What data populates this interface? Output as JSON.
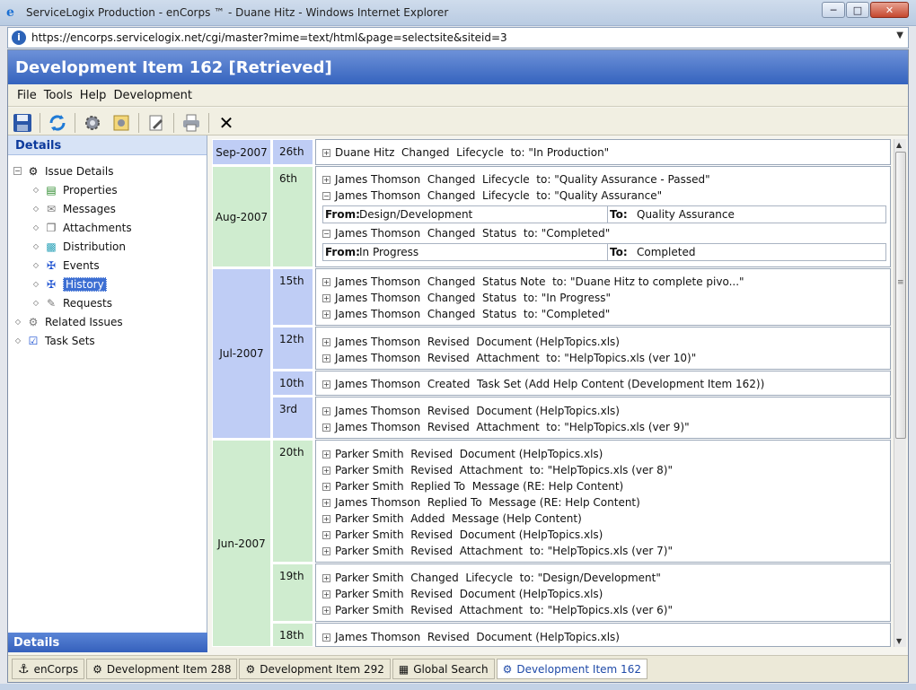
{
  "window": {
    "title": "ServiceLogix Production - enCorps ™ - Duane Hitz - Windows Internet Explorer",
    "url": "https://encorps.servicelogix.net/cgi/master?mime=text/html&page=selectsite&siteid=3"
  },
  "app": {
    "title": "Development Item 162 [Retrieved]"
  },
  "menu": {
    "file": "File",
    "tools": "Tools",
    "help": "Help",
    "development": "Development"
  },
  "toolbar": {
    "icons": [
      "save-icon",
      "refresh-icon",
      "settings-icon",
      "properties-icon",
      "edit-icon",
      "print-icon",
      "close-icon"
    ],
    "close": "✕"
  },
  "sidebar": {
    "header": "Details",
    "footer": "Details",
    "items": [
      {
        "label": "Issue Details"
      },
      {
        "label": "Properties"
      },
      {
        "label": "Messages"
      },
      {
        "label": "Attachments"
      },
      {
        "label": "Distribution"
      },
      {
        "label": "Events"
      },
      {
        "label": "History"
      },
      {
        "label": "Requests"
      },
      {
        "label": "Related Issues"
      },
      {
        "label": "Task Sets"
      }
    ]
  },
  "history": {
    "months": [
      "Sep-2007",
      "Aug-2007",
      "Jul-2007",
      "Jun-2007"
    ],
    "days": [
      "26th",
      "6th",
      "15th",
      "12th",
      "10th",
      "3rd",
      "20th",
      "19th",
      "18th"
    ],
    "rows": [
      "Duane Hitz  Changed  Lifecycle  to: \"In Production\"",
      "James Thomson  Changed  Lifecycle  to: \"Quality Assurance - Passed\"",
      "James Thomson  Changed  Lifecycle  to: \"Quality Assurance\"",
      "James Thomson  Changed  Status  to: \"Completed\"",
      "James Thomson  Changed  Status Note  to: \"Duane Hitz to complete pivo...\"",
      "James Thomson  Changed  Status  to: \"In Progress\"",
      "James Thomson  Changed  Status  to: \"Completed\"",
      "James Thomson  Revised  Document (HelpTopics.xls)",
      "James Thomson  Revised  Attachment  to: \"HelpTopics.xls (ver 10)\"",
      "James Thomson  Created  Task Set (Add Help Content (Development Item 162))",
      "James Thomson  Revised  Document (HelpTopics.xls)",
      "James Thomson  Revised  Attachment  to: \"HelpTopics.xls (ver 9)\"",
      "Parker Smith  Revised  Document (HelpTopics.xls)",
      "Parker Smith  Revised  Attachment  to: \"HelpTopics.xls (ver 8)\"",
      "Parker Smith  Replied To  Message (RE: Help Content)",
      "James Thomson  Replied To  Message (RE: Help Content)",
      "Parker Smith  Added  Message (Help Content)",
      "Parker Smith  Revised  Document (HelpTopics.xls)",
      "Parker Smith  Revised  Attachment  to: \"HelpTopics.xls (ver 7)\"",
      "Parker Smith  Changed  Lifecycle  to: \"Design/Development\"",
      "Parker Smith  Revised  Document (HelpTopics.xls)",
      "Parker Smith  Revised  Attachment  to: \"HelpTopics.xls (ver 6)\"",
      "James Thomson  Revised  Document (HelpTopics.xls)"
    ],
    "details": [
      {
        "from_label": "From:",
        "from": "Design/Development",
        "to_label": "To:",
        "to": "Quality Assurance"
      },
      {
        "from_label": "From:",
        "from": "In Progress",
        "to_label": "To:",
        "to": "Completed"
      }
    ]
  },
  "tabs": [
    {
      "label": "enCorps"
    },
    {
      "label": "Development Item 288"
    },
    {
      "label": "Development Item 292"
    },
    {
      "label": "Global Search"
    },
    {
      "label": "Development Item 162"
    }
  ],
  "colors": {
    "title_blue": "#3563be",
    "month_blue": "#bfcdf5",
    "month_green": "#cfeccf",
    "active_tab_text": "#1f4aa8"
  }
}
